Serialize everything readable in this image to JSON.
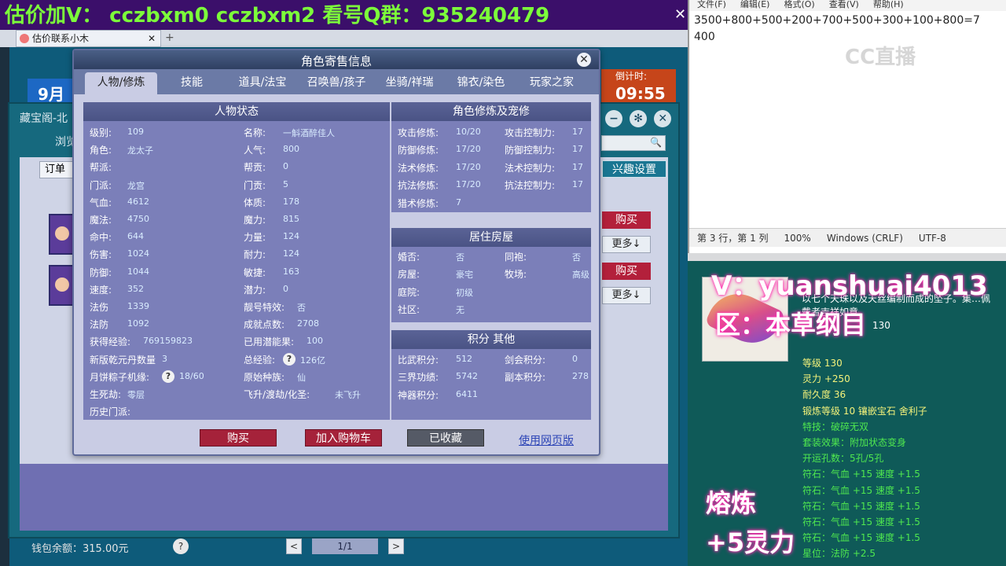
{
  "banner": {
    "text": "估价加V： cczbxm0   cczbxm2   看号Q群：935240479",
    "close": "✕"
  },
  "browser": {
    "tab_title": "估价联系小木",
    "tab_close": "✕",
    "new_tab": "+"
  },
  "background": {
    "left_banner": "9月",
    "right_banner_small": "倒计时:",
    "right_banner_big": "09:55",
    "cbg_title": "藏宝阁-北",
    "cbg_browse": "浏览",
    "order_button": "订单",
    "interest_button": "兴趣设置",
    "buy_label": "购买",
    "more_label": "更多↓",
    "wallet": "钱包余额：315.00元",
    "wallet_help": "?",
    "pager_prev": "<",
    "pager_info": "1/1",
    "pager_next": ">"
  },
  "dialog": {
    "title": "角色寄售信息",
    "close": "✕",
    "tabs": [
      {
        "label": "人物/修炼",
        "active": true
      },
      {
        "label": "技能"
      },
      {
        "label": "道具/法宝"
      },
      {
        "label": "召唤兽/孩子"
      },
      {
        "label": "坐骑/祥瑞"
      },
      {
        "label": "锦衣/染色"
      },
      {
        "label": "玩家之家"
      }
    ],
    "status": {
      "header": "人物状态",
      "left": [
        {
          "label": "级别:",
          "value": "109"
        },
        {
          "label": "角色:",
          "value": "龙太子"
        },
        {
          "label": "帮派:",
          "value": ""
        },
        {
          "label": "门派:",
          "value": "龙宫"
        },
        {
          "label": "气血:",
          "value": "4612"
        },
        {
          "label": "魔法:",
          "value": "4750"
        },
        {
          "label": "命中:",
          "value": "644"
        },
        {
          "label": "伤害:",
          "value": "1024"
        },
        {
          "label": "防御:",
          "value": "1044"
        },
        {
          "label": "速度:",
          "value": "352"
        },
        {
          "label": "法伤",
          "value": "1339"
        },
        {
          "label": "法防",
          "value": "1092"
        },
        {
          "label": "获得经验:",
          "value": "769159823"
        },
        {
          "label": "新版乾元丹数量",
          "value": "3"
        },
        {
          "label": "月饼粽子机缘:",
          "value": "18/60",
          "help": true
        },
        {
          "label": "生死劫:",
          "value": "零层"
        },
        {
          "label": "历史门派:",
          "value": ""
        }
      ],
      "right": [
        {
          "label": "名称:",
          "value": "一斛酒醉佳人"
        },
        {
          "label": "人气:",
          "value": "800"
        },
        {
          "label": "帮贡:",
          "value": "0"
        },
        {
          "label": "门贡:",
          "value": "5"
        },
        {
          "label": "体质:",
          "value": "178"
        },
        {
          "label": "魔力:",
          "value": "815"
        },
        {
          "label": "力量:",
          "value": "124"
        },
        {
          "label": "耐力:",
          "value": "124"
        },
        {
          "label": "敏捷:",
          "value": "163"
        },
        {
          "label": "潜力:",
          "value": "0"
        },
        {
          "label": "靓号特效:",
          "value": "否"
        },
        {
          "label": "成就点数:",
          "value": "2708"
        },
        {
          "label": "已用潜能果:",
          "value": "100"
        },
        {
          "label": "总经验:",
          "value": "126亿",
          "help": true
        },
        {
          "label": "原始种族:",
          "value": "仙"
        },
        {
          "label": "飞升/渡劫/化圣:",
          "value": "未飞升"
        }
      ]
    },
    "cultivation": {
      "header": "角色修炼及宠修",
      "rows": [
        {
          "label": "攻击修炼:",
          "value": "10/20",
          "label2": "攻击控制力:",
          "value2": "17"
        },
        {
          "label": "防御修炼:",
          "value": "17/20",
          "label2": "防御控制力:",
          "value2": "17"
        },
        {
          "label": "法术修炼:",
          "value": "17/20",
          "label2": "法术控制力:",
          "value2": "17"
        },
        {
          "label": "抗法修炼:",
          "value": "17/20",
          "label2": "抗法控制力:",
          "value2": "17"
        },
        {
          "label": "猎术修炼:",
          "value": "7",
          "label2": "",
          "value2": ""
        }
      ]
    },
    "housing": {
      "header": "居住房屋",
      "rows": [
        {
          "label": "婚否:",
          "value": "否",
          "label2": "同袍:",
          "value2": "否"
        },
        {
          "label": "房屋:",
          "value": "豪宅",
          "label2": "牧场:",
          "value2": "高级"
        },
        {
          "label": "庭院:",
          "value": "初级",
          "label2": "",
          "value2": ""
        },
        {
          "label": "社区:",
          "value": "无",
          "label2": "",
          "value2": ""
        }
      ]
    },
    "points": {
      "header": "积分 其他",
      "rows": [
        {
          "label": "比武积分:",
          "value": "512",
          "label2": "剑会积分:",
          "value2": "0"
        },
        {
          "label": "三界功绩:",
          "value": "5742",
          "label2": "副本积分:",
          "value2": "278"
        },
        {
          "label": "神器积分:",
          "value": "6411",
          "label2": "",
          "value2": ""
        }
      ]
    },
    "buttons": {
      "buy": "购买",
      "add_cart": "加入购物车",
      "collected": "已收藏",
      "web_version": "使用网页版"
    }
  },
  "notepad": {
    "menu": [
      "文件(F)",
      "编辑(E)",
      "格式(O)",
      "查看(V)",
      "帮助(H)"
    ],
    "text": "3500+800+500+200+700+500+300+100+800=7\n400",
    "status": [
      "第 3 行，第 1 列",
      "100%",
      "Windows (CRLF)",
      "UTF-8"
    ],
    "watermark": "CC直播"
  },
  "item": {
    "overlay_v": "V：yuanshuai4013",
    "overlay_qu": "区：本草纲目",
    "desc": "以七个天珠以及天丝编制而成的坠子。集…佩戴者吉祥如意。",
    "desc_num": "130",
    "attrs": [
      {
        "text": "等级 130",
        "color": "yellow"
      },
      {
        "text": "灵力 +250",
        "color": "yellow"
      },
      {
        "text": "耐久度 36",
        "color": "yellow"
      },
      {
        "text": "锻炼等级 10  镶嵌宝石 舍利子",
        "color": "yellow"
      },
      {
        "text": "特技：破碎无双",
        "color": "green"
      },
      {
        "text": "套装效果：附加状态变身",
        "color": "green"
      },
      {
        "text": "开运孔数：5孔/5孔",
        "color": "green"
      },
      {
        "text": "符石：气血 +15 速度 +1.5",
        "color": "green"
      },
      {
        "text": "符石：气血 +15 速度 +1.5",
        "color": "green"
      },
      {
        "text": "符石：气血 +15 速度 +1.5",
        "color": "green"
      },
      {
        "text": "符石：气血 +15 速度 +1.5",
        "color": "green"
      },
      {
        "text": "符石：气血 +15 速度 +1.5",
        "color": "green"
      },
      {
        "text": "星位：法防 +2.5",
        "color": "green"
      }
    ],
    "overlay_rong": "熔炼",
    "overlay_plus": "+5灵力"
  }
}
